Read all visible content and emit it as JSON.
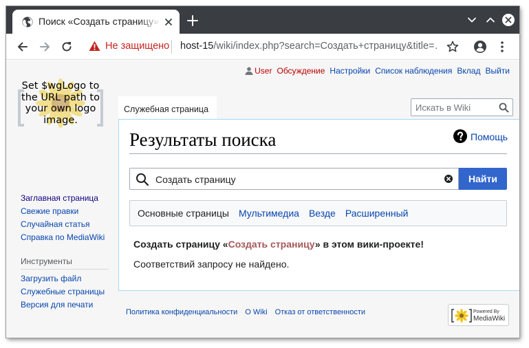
{
  "browser": {
    "tab_title": "Поиск «Создать страницу» — MediaWiki",
    "security_label": "Не защищено",
    "url_host": "host-15",
    "url_path": "/wiki/index.php?search=Создать+страницу&title=…",
    "accent_warning": "#c5221f"
  },
  "personal": {
    "user": "User",
    "talk": "Обсуждение",
    "preferences": "Настройки",
    "watchlist": "Список наблюдения",
    "contributions": "Вклад",
    "logout": "Выйти"
  },
  "logo_text": "Set $wgLogo to the URL path to your own logo image.",
  "navigation": [
    "Заглавная страница",
    "Свежие правки",
    "Случайная статья",
    "Справка по MediaWiki"
  ],
  "tools": {
    "heading": "Инструменты",
    "items": [
      "Загрузить файл",
      "Служебные страницы",
      "Версия для печати"
    ]
  },
  "namespace_tab": "Служебная страница",
  "header_search_placeholder": "Искать в Wiki",
  "help_label": "Помощь",
  "page_title": "Результаты поиска",
  "search": {
    "query": "Создать страницу",
    "button": "Найти"
  },
  "profiles": [
    "Основные страницы",
    "Мультимедиа",
    "Везде",
    "Расширенный"
  ],
  "result": {
    "prefix": "Создать страницу «",
    "link": "Создать страницу",
    "suffix": "» в этом вики-проекте!",
    "no_match": "Соответствий запросу не найдено."
  },
  "footer": [
    "Политика конфиденциальности",
    "О Wiki",
    "Отказ от ответственности"
  ],
  "powered_by": {
    "small": "Powered By",
    "big": "MediaWiki"
  },
  "colors": {
    "link": "#0645ad",
    "visited": "#0b0080",
    "new_link": "#ba0000",
    "button": "#3366cc",
    "tab_strip": "#3a3d41"
  }
}
